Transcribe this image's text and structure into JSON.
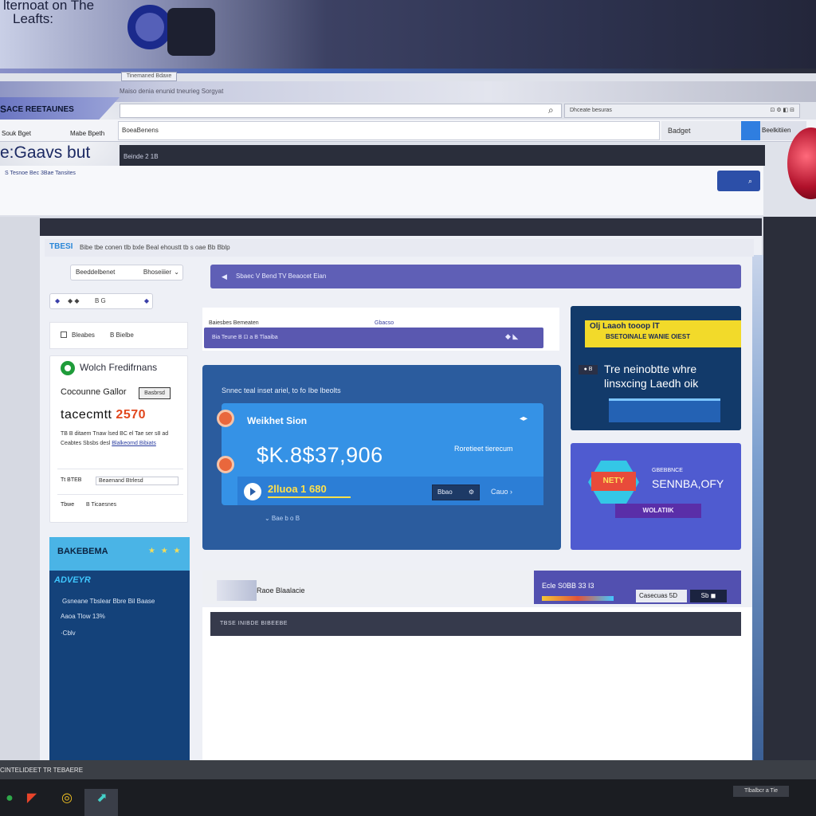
{
  "hero": {
    "title_line1": "lternoat on The",
    "title_line2": "Leafts:"
  },
  "browser": {
    "small_tab": "Tinemaned Bdaxe",
    "tabstrip_text": "Maiso denia enunid tneurieg Sorgyat",
    "side_badge": "ACE REETAUNES",
    "side_badge_icon": "S",
    "address_right": "Dhceate besuras",
    "address_right_icons": "⊡ ⚙ ◧ ⊟",
    "row2_left": "Souk Bget",
    "row2_left2": "Mabe Bpeth",
    "row2_field": "BoeaBenens",
    "budget": "Badget",
    "description": "Beelkitiien",
    "row3_text": "Beinde 2 1B",
    "big_subtitle": "e:Gaavs but",
    "big_subtitle_small": "S Tesnoe Bec 3Bae Tansites",
    "row4_button": "⌕"
  },
  "app": {
    "breadcrumb_logo": "TBESI",
    "breadcrumb_text": "Bibe tbe conen tlb bxle Beal ehoustt tb s oae Bb Bblp",
    "filter_left": "Beeddelbenet",
    "filter_right": "Bhoseiiier",
    "pager": {
      "a": "◆",
      "b": "◆ ◆",
      "c": "B G",
      "d": "◆"
    },
    "checkbox_label": "Bleabes",
    "checkbox_label2": "B  Bielbe",
    "info": {
      "title": "Wolch Fredifrnans",
      "row1": "Cocounne Gallor",
      "tag": "Basbrsd",
      "big_prefix": "tacecmtt",
      "big_number": "2570",
      "small_text": "TB B ditaem Tnaw lsed BC el Tae ser s8 ad Ceabtes Sbsbs desl",
      "small_link": "Blalkeomd Bibiats",
      "row3_label": "Tt BTEB",
      "row3_value": "Beaenand  Btrlesd",
      "row4_label": "Tbwe",
      "row4_value": "B  Ticaesnes"
    },
    "side_panel": {
      "head": "BAKEBEMA",
      "stars": "★ ★ ★",
      "subtitle": "ADVEYR",
      "line1": "Gsneane  Tbslear Bbre Bil Baase",
      "line2": "Aaoa Tlow    13%",
      "line3": "·Cblv"
    },
    "top_tab": "Sbaec  V  Bend  TV  Beaocet  Eian",
    "top_tab_icon": "◀",
    "sub_card_label": "Baiesbes Bemeaten",
    "sub_card_label2": "Gbacso",
    "sub_bar": "Bia Teune B  ⊡ a  B  Tlaaiba",
    "sub_bar_icons": "◆  ◣",
    "main_card": {
      "caption": "Snnec teal inset ariel, to fo Ibe lbeolts",
      "inner_title": "Weikhet Sion",
      "inner_dots": "◂▸",
      "amount": "$K.8$37,906",
      "right_text": "Roretieet tierecum",
      "bar_text": "2lluoa  1 680",
      "bar_button": "Bbao",
      "bar_button_icon": "⚙",
      "bar_link": "Cauo  ›",
      "foot": "⌄ Bae b o B"
    },
    "card_r1": {
      "band_line1": "Olj  Laaoh tooop  lT",
      "band_line2": "BSETOINALE WANIE OIEST",
      "chip": "● B",
      "title_line1": "Tre neinobtte whre",
      "title_line2": "linsxcing Laedh oik"
    },
    "card_r2": {
      "hex": "NETY",
      "line1": "GBEBBNCE",
      "line2": "SENNBA,OFY",
      "button": "WOLATIIK"
    },
    "promo": {
      "left_text": "Raoe Blaalacie",
      "right_text": "Ecle S0BB 33  I3",
      "right_button": "Casecuas 5D",
      "right_icons": "Sb ◼"
    },
    "list_head": "TBSE  INIBDE  BIBEEBE"
  },
  "taskbar": {
    "status": "CINTELIDEET TR TEBAERE",
    "icons": [
      "●",
      "◤",
      "◎",
      "⬈"
    ],
    "tray": "Tlbalbcr a Tie"
  },
  "colors": {
    "accent_purple": "#5f5fb6",
    "main_blue": "#2b5c9e",
    "inner_blue": "#3592e6",
    "highlight_orange": "#e1471d",
    "promo_yellow": "#f2da2a"
  }
}
